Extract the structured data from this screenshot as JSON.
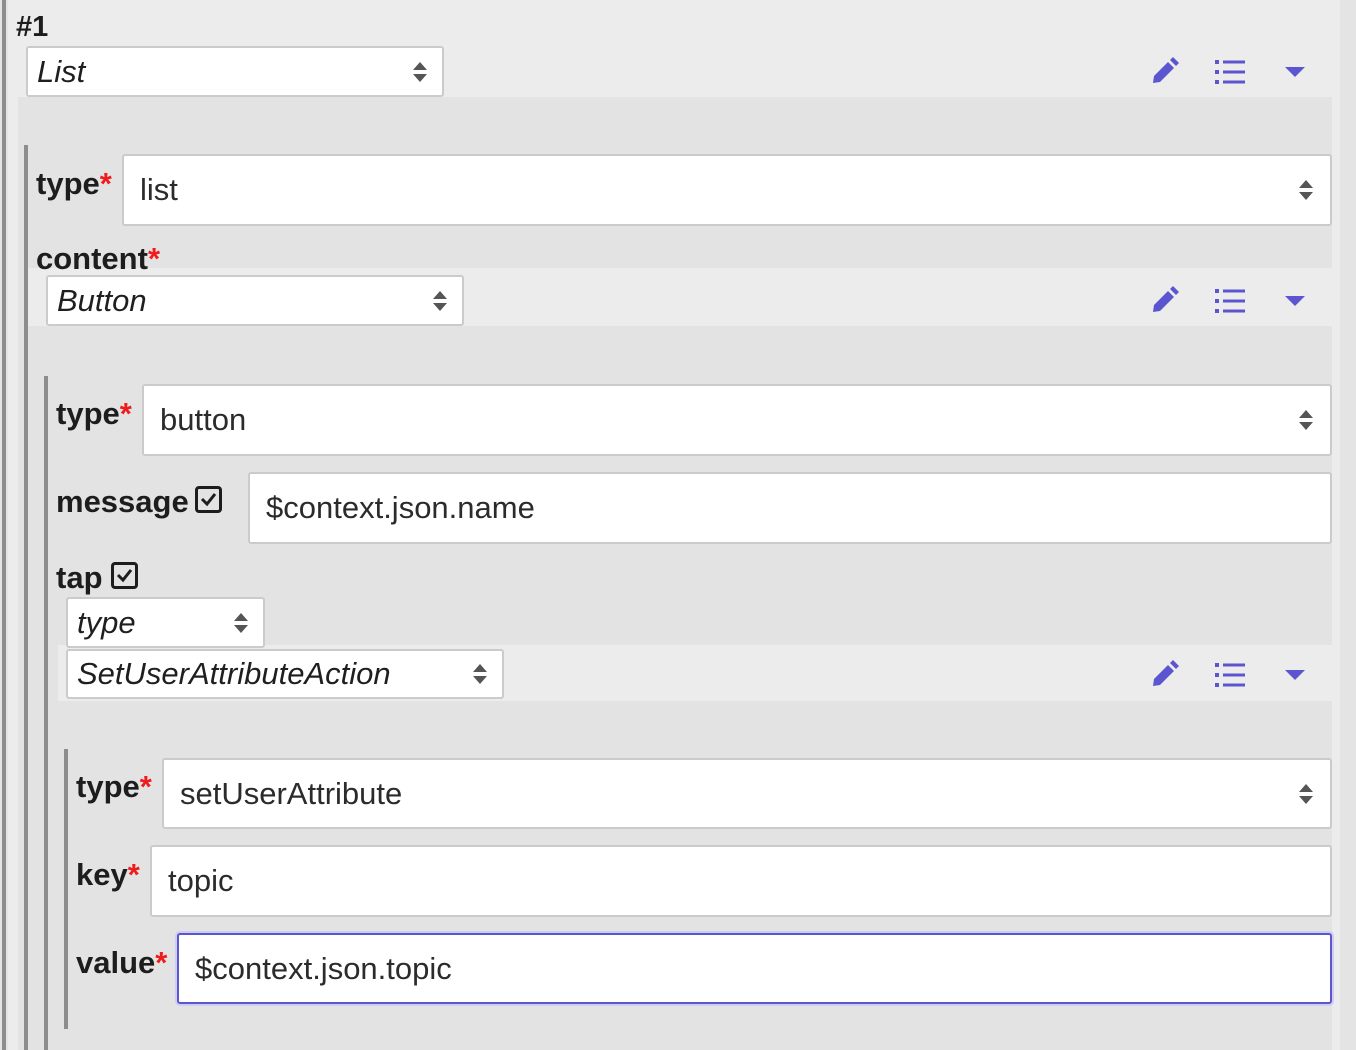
{
  "item_index": "#1",
  "colors": {
    "accent": "#5b56d0",
    "required": "#ee1c1c",
    "border": "#cbcbcb"
  },
  "root": {
    "kind_select": "List",
    "toolbar": {
      "edit_icon": "pencil-icon",
      "properties_icon": "list-icon",
      "collapse_icon": "caret-down-icon"
    },
    "type_label": "type",
    "type_value": "list",
    "content_label": "content",
    "content": {
      "kind_select": "Button",
      "type_label": "type",
      "type_value": "button",
      "message_label": "message",
      "message_enabled": true,
      "message_value": "$context.json.name",
      "tap_label": "tap",
      "tap_enabled": true,
      "tap": {
        "discriminator_select": "type",
        "kind_select": "SetUserAttributeAction",
        "type_label": "type",
        "type_value": "setUserAttribute",
        "key_label": "key",
        "key_value": "topic",
        "value_label": "value",
        "value_value": "$context.json.topic"
      }
    }
  },
  "required_marker": "*"
}
